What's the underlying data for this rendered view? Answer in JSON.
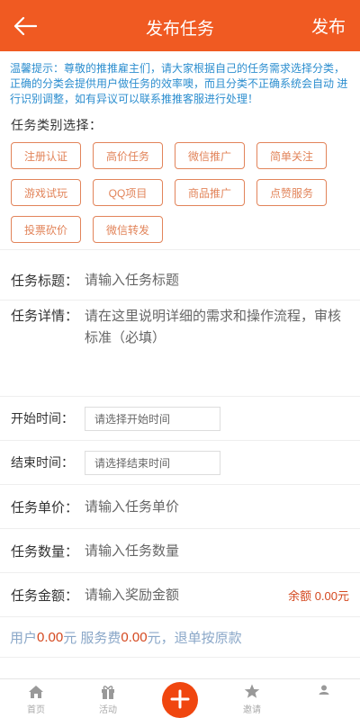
{
  "header": {
    "title": "发布任务",
    "publish_label": "发布"
  },
  "tip": "温馨提示：尊敬的推推雇主们，请大家根据自己的任务需求选择分类， 正确的分类会提供用户做任务的效率噢，而且分类不正确系统会自动 进行识别调整，如有异议可以联系推推客服进行处理！",
  "category_label": "任务类别选择：",
  "categories": [
    "注册认证",
    "高价任务",
    "微信推广",
    "简单关注",
    "游戏试玩",
    "QQ项目",
    "商品推广",
    "点赞服务",
    "投票砍价",
    "微信转发"
  ],
  "form": {
    "title_label": "任务标题：",
    "title_placeholder": "请输入任务标题",
    "detail_label": "任务详情：",
    "detail_placeholder": "请在这里说明详细的需求和操作流程，审核标准（必填）",
    "start_label": "开始时间：",
    "start_placeholder": "请选择开始时间",
    "end_label": "结束时间：",
    "end_placeholder": "请选择结束时间",
    "price_label": "任务单价：",
    "price_placeholder": "请输入任务单价",
    "qty_label": "任务数量：",
    "qty_placeholder": "请输入任务数量",
    "amount_label": "任务金额：",
    "amount_placeholder": "请输入奖励金额",
    "balance_text": "余额 0.00元"
  },
  "fee": {
    "user_label": "用户 ",
    "user_value": "0.00",
    "unit1": "元 服务费 ",
    "service_value": "0.00",
    "unit2": "元，退单按原款"
  },
  "tabs": [
    {
      "label": "首页",
      "icon": "home-icon"
    },
    {
      "label": "活动",
      "icon": "gift-icon"
    },
    {
      "label": "",
      "icon": "plus-icon"
    },
    {
      "label": "邀请",
      "icon": "star-icon"
    },
    {
      "label": "",
      "icon": "user-icon"
    }
  ],
  "colors": {
    "accent": "#f05a22",
    "tip": "#2c8ecf",
    "category_border": "#e2845a",
    "money": "#d4481f"
  }
}
